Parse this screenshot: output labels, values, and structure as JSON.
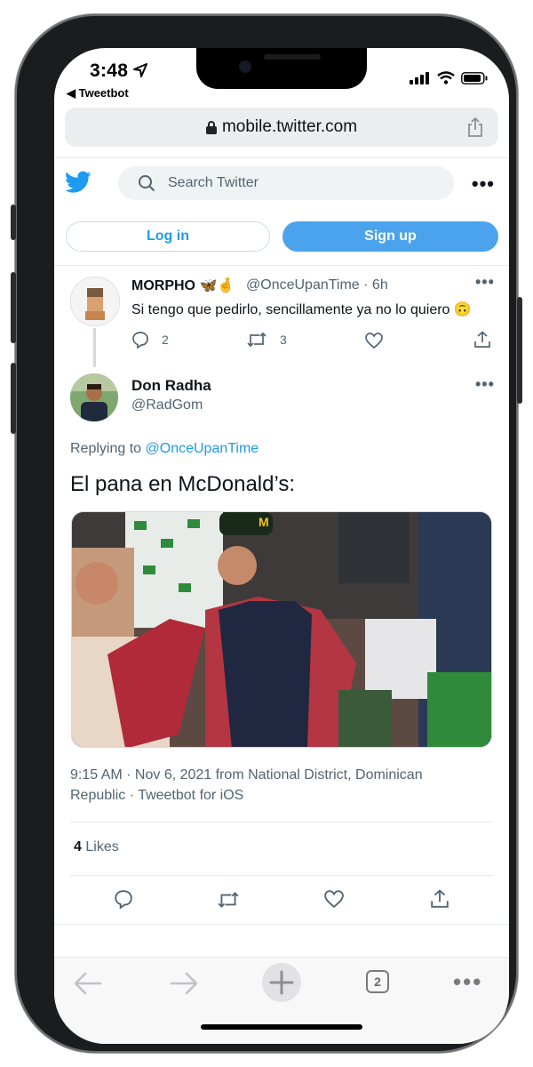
{
  "status_bar": {
    "time": "3:48",
    "back_app": "Tweetbot"
  },
  "browser": {
    "url": "mobile.twitter.com"
  },
  "header": {
    "search_placeholder": "Search Twitter",
    "login_label": "Log in",
    "signup_label": "Sign up"
  },
  "parent_tweet": {
    "name": "MORPHO",
    "name_emoji": "🦋🤞",
    "handle": "@OnceUpanTime",
    "time": "· 6h",
    "text": "Si tengo que pedirlo, sencillamente ya no lo quiero",
    "text_emoji": "🙃",
    "reply_count": "2",
    "retweet_count": "3"
  },
  "main_tweet": {
    "name": "Don Radha",
    "handle": "@RadGom",
    "replying_prefix": "Replying to",
    "replying_to": "@OnceUpanTime",
    "text": "El pana en McDonald’s:",
    "meta_line1": "9:15 AM · Nov 6, 2021 from National District, Dominican",
    "meta_line2": "Republic · Tweetbot for iOS",
    "likes_count": "4",
    "likes_label": "Likes"
  },
  "toolbar": {
    "tabs_count": "2"
  },
  "colors": {
    "twitter_blue": "#1d9bf0",
    "signup_bg": "#4aa3ec",
    "text_gray": "#536471"
  },
  "icons": [
    "location-arrow-icon",
    "signal-icon",
    "wifi-icon",
    "battery-icon",
    "lock-icon",
    "share-icon",
    "twitter-logo-icon",
    "search-icon",
    "more-icon",
    "reply-icon",
    "retweet-icon",
    "like-icon",
    "back-icon",
    "forward-icon",
    "new-tab-icon",
    "tabs-icon"
  ]
}
